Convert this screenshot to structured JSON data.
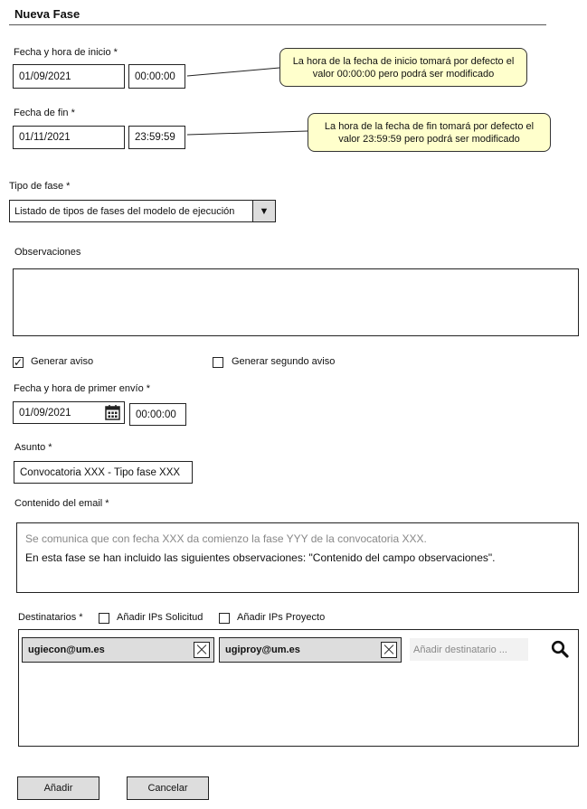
{
  "form": {
    "title": "Nueva Fase",
    "start": {
      "label": "Fecha y hora de inicio *",
      "date": "01/09/2021",
      "time": "00:00:00",
      "note": "La hora de la fecha de inicio tomará por defecto el valor 00:00:00 pero podrá ser modificado"
    },
    "end": {
      "label": "Fecha de fin *",
      "date": "01/11/2021",
      "time": "23:59:59",
      "note": "La hora de la fecha de fin tomará por defecto el valor 23:59:59 pero podrá ser modificado"
    },
    "phase_type": {
      "label": "Tipo de fase *",
      "value": "Listado de tipos de fases del modelo de ejecución",
      "arrow": "▼"
    },
    "observations": {
      "label": "Observaciones",
      "value": ""
    },
    "alerts": {
      "generate": {
        "label": "Generar aviso",
        "checked": true,
        "mark": "✓"
      },
      "second": {
        "label": "Generar segundo aviso",
        "checked": false
      }
    },
    "first_send": {
      "label": "Fecha y hora de primer envío *",
      "date": "01/09/2021",
      "time": "00:00:00",
      "icon": "calendar-icon"
    },
    "subject": {
      "label": "Asunto *",
      "value": "Convocatoria XXX - Tipo fase XXX"
    },
    "email_body": {
      "label": "Contenido del email *",
      "placeholder": "Se comunica que con fecha XXX da comienzo la fase YYY de la convocatoria XXX.",
      "line2": "En esta fase se han incluido las siguientes observaciones: \"Contenido del campo observaciones\"."
    },
    "recipients": {
      "label": "Destinatarios *",
      "add_request_ips": "Añadir IPs Solicitud",
      "add_project_ips": "Añadir IPs Proyecto",
      "chips": [
        "ugiecon@um.es",
        "ugiproy@um.es"
      ],
      "add_placeholder": "Añadir destinatario ...",
      "search_icon": "search-icon"
    },
    "buttons": {
      "add": "Añadir",
      "cancel": "Cancelar"
    }
  }
}
